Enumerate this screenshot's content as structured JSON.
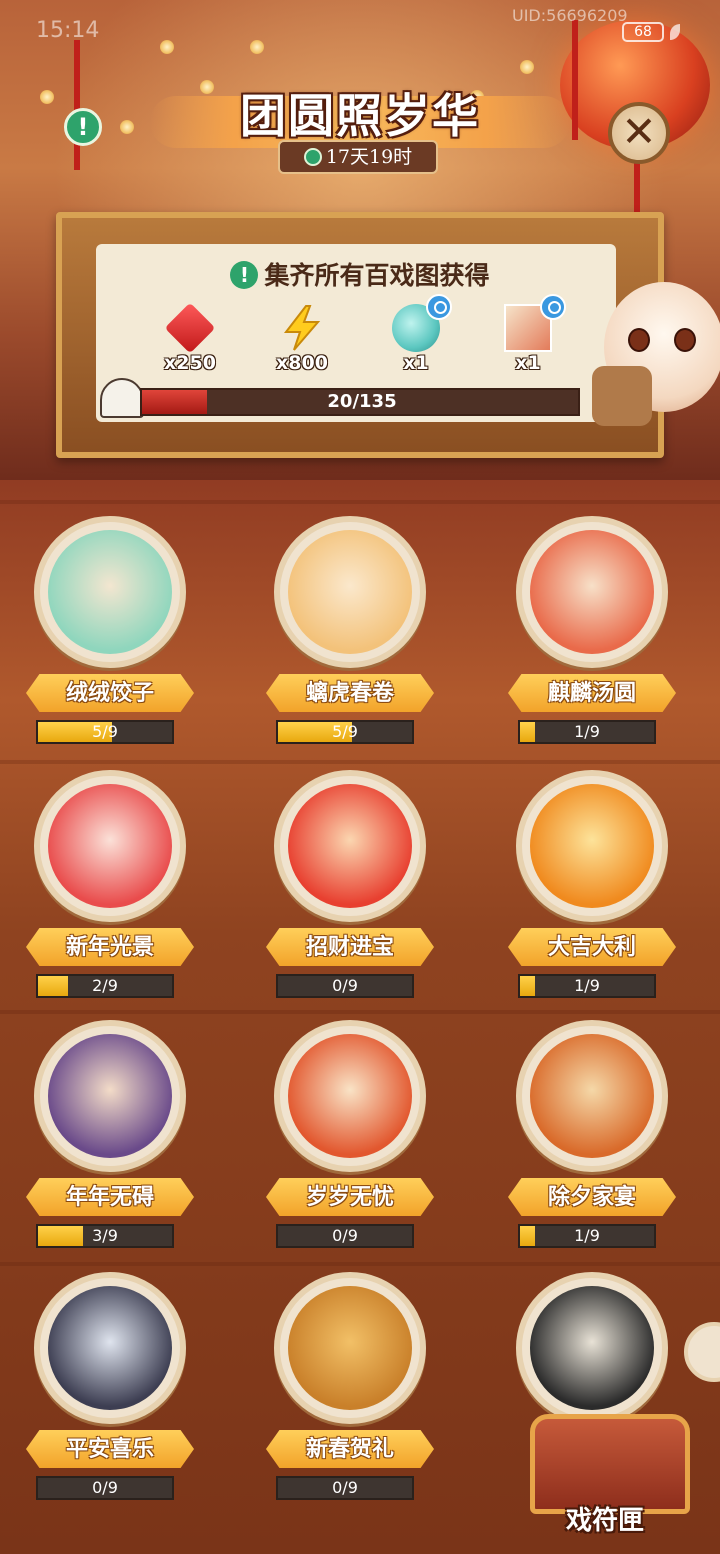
{
  "status": {
    "time": "15:14",
    "uid": "UID:56696209",
    "battery": "68"
  },
  "header": {
    "title": "团圆照岁华",
    "timer": "17天19时"
  },
  "reward_panel": {
    "title": "集齐所有百戏图获得",
    "rewards": [
      {
        "icon": "red-gem-icon",
        "qty": "x250"
      },
      {
        "icon": "lightning-icon",
        "qty": "x800"
      },
      {
        "icon": "spirit-figure-icon",
        "qty": "x1"
      },
      {
        "icon": "portrait-frame-icon",
        "qty": "x1"
      }
    ],
    "progress": {
      "text": "20/135",
      "current": 20,
      "total": 135
    }
  },
  "items": [
    {
      "name": "绒绒饺子",
      "progress": "5/9",
      "current": 5,
      "total": 9,
      "palette": [
        "#8fd6bd",
        "#f3e6d0"
      ]
    },
    {
      "name": "螭虎春卷",
      "progress": "5/9",
      "current": 5,
      "total": 9,
      "palette": [
        "#f3c27a",
        "#fbe8cc"
      ]
    },
    {
      "name": "麒麟汤圆",
      "progress": "1/9",
      "current": 1,
      "total": 9,
      "palette": [
        "#e96a4a",
        "#f7e0c8"
      ]
    },
    {
      "name": "新年光景",
      "progress": "2/9",
      "current": 2,
      "total": 9,
      "palette": [
        "#e94c4c",
        "#fbe1d8"
      ]
    },
    {
      "name": "招财进宝",
      "progress": "0/9",
      "current": 0,
      "total": 9,
      "palette": [
        "#e84030",
        "#fbd6b0"
      ]
    },
    {
      "name": "大吉大利",
      "progress": "1/9",
      "current": 1,
      "total": 9,
      "palette": [
        "#f08a1e",
        "#fde39a"
      ]
    },
    {
      "name": "年年无碍",
      "progress": "3/9",
      "current": 3,
      "total": 9,
      "palette": [
        "#6a4a8a",
        "#f3dcc8"
      ]
    },
    {
      "name": "岁岁无忧",
      "progress": "0/9",
      "current": 0,
      "total": 9,
      "palette": [
        "#e2572e",
        "#f9e3c6"
      ]
    },
    {
      "name": "除夕家宴",
      "progress": "1/9",
      "current": 1,
      "total": 9,
      "palette": [
        "#d96a2a",
        "#f5d8a8"
      ]
    },
    {
      "name": "平安喜乐",
      "progress": "0/9",
      "current": 0,
      "total": 9,
      "palette": [
        "#3d3e52",
        "#dfe4ee"
      ]
    },
    {
      "name": "新春贺礼",
      "progress": "0/9",
      "current": 0,
      "total": 9,
      "palette": [
        "#c9802a",
        "#f2c067"
      ]
    },
    {
      "name": "",
      "progress": "",
      "current": 0,
      "total": 9,
      "palette": [
        "#2b2b2b",
        "#e8e2d6"
      ]
    }
  ],
  "chest": {
    "label": "戏符匣"
  },
  "colors": {
    "accent": "#f2a32a",
    "progress_red": "#c0201a",
    "progress_gold": "#ffd24a"
  }
}
